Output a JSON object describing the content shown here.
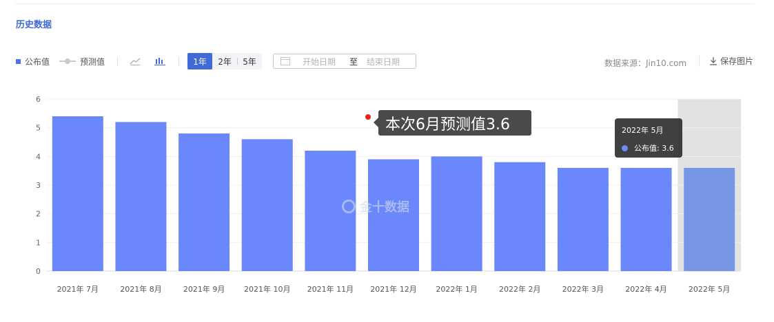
{
  "section_title": "历史数据",
  "legend": {
    "published": "公布值",
    "forecast": "预测值"
  },
  "range_buttons": [
    "1年",
    "2年",
    "5年"
  ],
  "active_range": "1年",
  "date_range": {
    "start_placeholder": "开始日期",
    "to": "至",
    "end_placeholder": "结束日期"
  },
  "source": "数据来源：Jin10.com",
  "save_label": "保存图片",
  "watermark": "金十数据",
  "annotation": "本次6月预测值3.6",
  "tooltip": {
    "title": "2022年 5月",
    "label": "公布值: 3.6"
  },
  "colors": {
    "bar": "#6a87fc",
    "bar_highlight": "#7896e6",
    "hover_band": "#e2e2e2",
    "accent": "#3f6ad8",
    "annotation_dot": "#e8231f"
  },
  "chart_data": {
    "type": "bar",
    "categories": [
      "2021年 7月",
      "2021年 8月",
      "2021年 9月",
      "2021年 10月",
      "2021年 11月",
      "2021年 12月",
      "2022年 1月",
      "2022年 2月",
      "2022年 3月",
      "2022年 4月",
      "2022年 5月"
    ],
    "series": [
      {
        "name": "公布值",
        "values": [
          5.4,
          5.2,
          4.8,
          4.6,
          4.2,
          3.9,
          4.0,
          3.8,
          3.6,
          3.6,
          3.6
        ]
      }
    ],
    "ylim": [
      0,
      6
    ],
    "yticks": [
      "0",
      "1",
      "2",
      "3",
      "4",
      "5",
      "6"
    ],
    "grid": true,
    "highlighted_category": "2022年 5月"
  }
}
